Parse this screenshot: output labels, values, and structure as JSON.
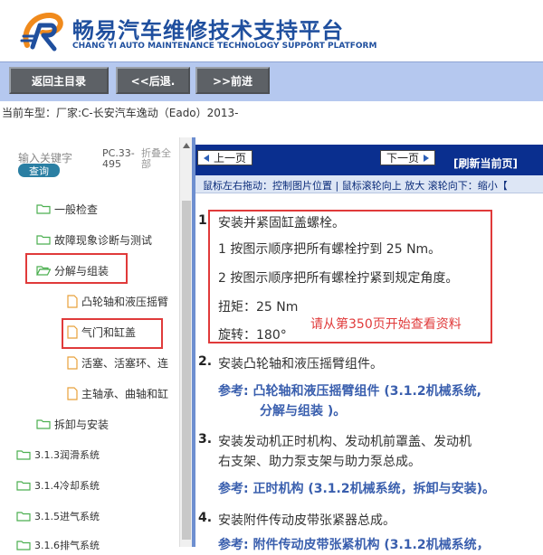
{
  "brand": {
    "title": "畅易汽车维修技术支持平台",
    "subtitle": "CHANG YI AUTO MAINTENANCE TECHNOLOGY SUPPORT PLATFORM",
    "logo_color": "#1f4f9e"
  },
  "toolbar": {
    "home_label": "返回主目录",
    "back_label": "<<后退.",
    "forward_label": ">>前进"
  },
  "status": {
    "text": "当前车型：厂家:C-长安汽车逸动（Eado）2013-"
  },
  "search": {
    "label": "输入关键字",
    "button": "查询",
    "pc_label": "PC.33-495",
    "fold_label": "折叠全部"
  },
  "tree": {
    "items": [
      {
        "label": "一般检查",
        "icon": "folder-icon"
      },
      {
        "label": "故障现象诊断与测试",
        "icon": "folder-icon"
      },
      {
        "label": "分解与组装",
        "icon": "folder-open-icon"
      },
      {
        "label": "凸轮轴和液压摇臂",
        "icon": "document-icon"
      },
      {
        "label": "气门和缸盖",
        "icon": "document-icon"
      },
      {
        "label": "活塞、活塞环、连",
        "icon": "document-icon"
      },
      {
        "label": "主轴承、曲轴和缸",
        "icon": "document-icon"
      },
      {
        "label": "拆卸与安装",
        "icon": "folder-icon"
      },
      {
        "label": "3.1.3润滑系统",
        "icon": "folder-icon"
      },
      {
        "label": "3.1.4冷却系统",
        "icon": "folder-icon"
      },
      {
        "label": "3.1.5进气系统",
        "icon": "folder-icon"
      },
      {
        "label": "3.1.6排气系统",
        "icon": "folder-icon"
      }
    ]
  },
  "pager": {
    "prev": "上一页",
    "next": "下一页",
    "refresh": "[刷新当前页]"
  },
  "hint": "鼠标左右拖动：控制图片位置 | 鼠标滚轮向上 放大  滚轮向下：缩小【",
  "content": {
    "step1_num": "1",
    "step1": "安装并紧固缸盖螺栓。",
    "step1_a": "1  按图示顺序把所有螺栓拧到 25 Nm。",
    "step1_b": "2  按图示顺序把所有螺栓拧紧到规定角度。",
    "torque": "扭矩：25 Nm",
    "rotation": "旋转：180°",
    "notice": "请从第350页开始查看资料",
    "step2_num": "2.",
    "step2": "安装凸轮轴和液压摇臂组件。",
    "ref2_line1": "参考: 凸轮轴和液压摇臂组件 (3.1.2机械系统,",
    "ref2_line2": "分解与组装 )。",
    "step3_num": "3.",
    "step3_line1": "安装发动机正时机构、发动机前罩盖、发动机",
    "step3_line2": "右支架、助力泵支架与助力泵总成。",
    "ref3": "参考: 正时机构 (3.1.2机械系统，拆卸与安装)。",
    "step4_num": "4.",
    "step4": "安装附件传动皮带张紧器总成。",
    "ref4": "参考: 附件传动皮带张紧机构 (3.1.2机械系统，"
  },
  "colors": {
    "toolbar_bg": "#b5c8ef",
    "nav_bg": "#0a2f8f",
    "highlight": "#e03a3a",
    "link": "#3a5fae"
  }
}
